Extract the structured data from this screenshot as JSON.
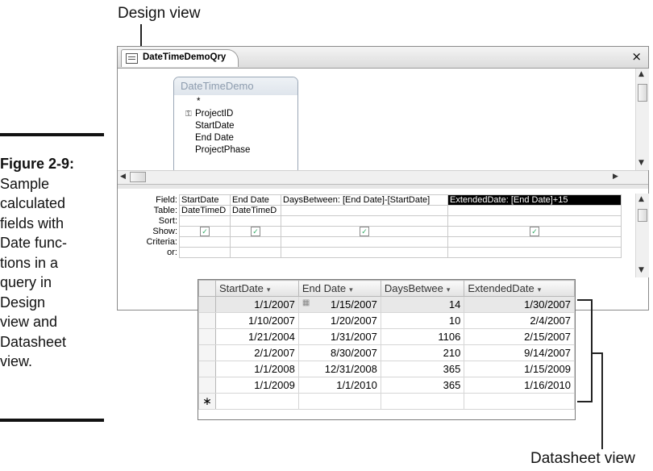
{
  "callouts": {
    "design_view": "Design view",
    "datasheet_view": "Datasheet view"
  },
  "caption": {
    "figure": "Figure 2-9:",
    "lines": [
      "Sample",
      "calculated",
      "fields with",
      "Date func-",
      "tions in a",
      "query in",
      "Design",
      "view and",
      "Datasheet",
      "view."
    ]
  },
  "window": {
    "tab_title": "DateTimeDemoQry",
    "close_glyph": "×"
  },
  "table_box": {
    "title": "DateTimeDemo",
    "fields": [
      "*",
      "ProjectID",
      "StartDate",
      "End  Date",
      "ProjectPhase"
    ]
  },
  "qbe": {
    "row_labels": [
      "Field:",
      "Table:",
      "Sort:",
      "Show:",
      "Criteria:",
      "or:"
    ],
    "fields": [
      "StartDate",
      "End  Date",
      "DaysBetween: [End  Date]-[StartDate]",
      "ExtendedDate: [End  Date]+15"
    ],
    "tables": [
      "DateTimeD",
      "DateTimeD",
      "",
      ""
    ],
    "show": [
      true,
      true,
      true,
      true
    ]
  },
  "datasheet": {
    "columns": [
      "StartDate",
      "End  Date",
      "DaysBetwee",
      "ExtendedDate"
    ],
    "rows": [
      [
        "1/1/2007",
        "1/15/2007",
        "14",
        "1/30/2007"
      ],
      [
        "1/10/2007",
        "1/20/2007",
        "10",
        "2/4/2007"
      ],
      [
        "1/21/2004",
        "1/31/2007",
        "1106",
        "2/15/2007"
      ],
      [
        "2/1/2007",
        "8/30/2007",
        "210",
        "9/14/2007"
      ],
      [
        "1/1/2008",
        "12/31/2008",
        "365",
        "1/15/2009"
      ],
      [
        "1/1/2009",
        "1/1/2010",
        "365",
        "1/16/2010"
      ]
    ],
    "new_row_marker": "∗"
  }
}
